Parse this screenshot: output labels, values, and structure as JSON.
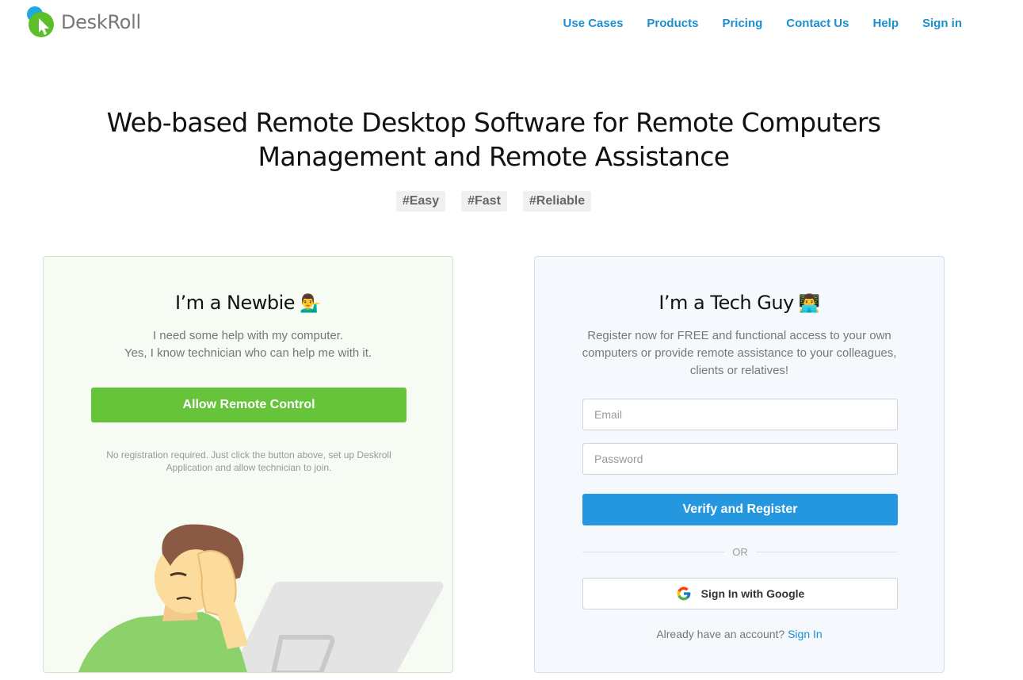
{
  "brand": {
    "name": "DeskRoll"
  },
  "nav": {
    "items": [
      {
        "label": "Use Cases"
      },
      {
        "label": "Products"
      },
      {
        "label": "Pricing"
      },
      {
        "label": "Contact Us"
      },
      {
        "label": "Help"
      },
      {
        "label": "Sign in"
      }
    ]
  },
  "hero": {
    "title_line1": "Web-based Remote Desktop Software for Remote Computers",
    "title_line2": "Management and Remote Assistance",
    "tags": [
      "#Easy",
      "#Fast",
      "#Reliable"
    ]
  },
  "newbie": {
    "title": "I’m a Newbie",
    "emoji": "💁‍♂️",
    "desc_line1": "I need some help with my computer.",
    "desc_line2": "Yes, I know technician who can help me with it.",
    "button_label": "Allow Remote Control",
    "note_line1": "No registration required. Just click the button above, set up Deskroll",
    "note_line2": "Application and allow technician to join."
  },
  "techguy": {
    "title": "I’m a Tech Guy",
    "emoji": "👨‍💻",
    "desc_line1": "Register now for FREE and functional access to your own",
    "desc_line2": "computers or provide remote assistance to your colleagues,",
    "desc_line3": "clients or relatives!",
    "email_placeholder": "Email",
    "password_placeholder": "Password",
    "register_label": "Verify and Register",
    "or_label": "OR",
    "google_label": "Sign In with Google",
    "already_text": "Already have an account?",
    "signin_link": "Sign In"
  },
  "colors": {
    "accent_blue": "#1a8fd1",
    "button_green": "#66c43a",
    "button_blue": "#2597df"
  }
}
